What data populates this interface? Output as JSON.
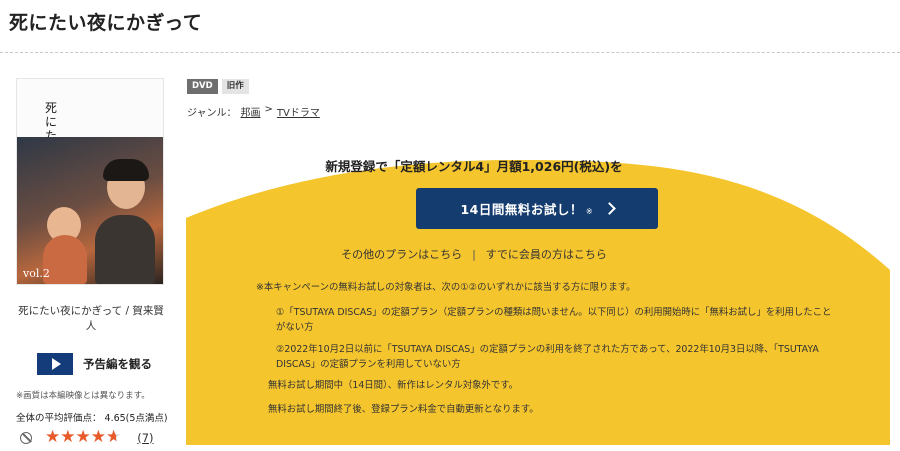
{
  "page": {
    "title": "死にたい夜にかぎって"
  },
  "product": {
    "cover_title": "死にたい夜にかぎって",
    "cover_volume": "vol.2",
    "name_line": "死にたい夜にかぎって / 賀来賢人",
    "trailer_label": "予告編を観る",
    "image_note": "※画質は本編映像とは異なります。",
    "rating_text": "全体の平均評価点： 4.65(5点満点)",
    "rating_value": 4.65,
    "rating_max": 5,
    "review_count": "(7)"
  },
  "badges": [
    "DVD",
    "旧作"
  ],
  "genre": {
    "label": "ジャンル：",
    "items": [
      "邦画",
      "TVドラマ"
    ],
    "separator": ">"
  },
  "campaign": {
    "headline": "新規登録で「定額レンタル4」月額1,026円(税込)を",
    "trial_button": "14日間無料お試し！",
    "trial_note": "※",
    "other_plans": "その他のプランはこちら",
    "link_separator": "|",
    "member_link": "すでに会員の方はこちら",
    "terms_intro": "※本キャンペーンの無料お試しの対象者は、次の①②のいずれかに該当する方に限ります。",
    "terms_1": "①「TSUTAYA DISCAS」の定額プラン（定額プランの種類は問いません。以下同じ）の利用開始時に「無料お試し」を利用したことがない方",
    "terms_2": "②2022年10月2日以前に「TSUTAYA DISCAS」の定額プランの利用を終了された方であって、2022年10月3日以降、「TSUTAYA DISCAS」の定額プランを利用していない方",
    "terms_3": "無料お試し期間中（14日間）、新作はレンタル対象外です。",
    "terms_4": "無料お試し期間終了後、登録プラン料金で自動更新となります。"
  },
  "colors": {
    "accent_navy": "#143c6e",
    "campaign_yellow": "#f5c52d",
    "star": "#e85a2a"
  },
  "icons": {
    "play": "play-icon",
    "chevron": "chevron-right-icon",
    "block": "block-icon",
    "star": "star-icon"
  }
}
